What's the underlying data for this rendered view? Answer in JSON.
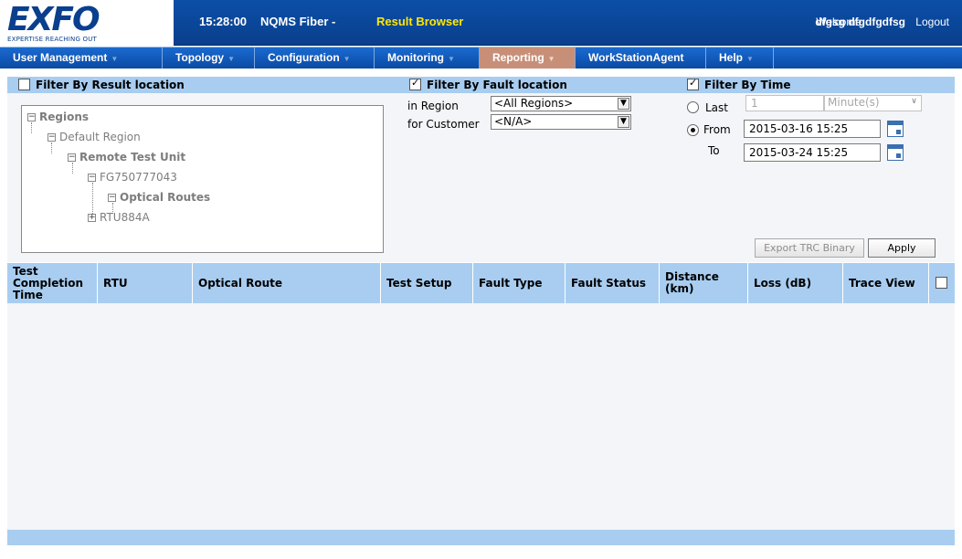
{
  "header": {
    "logo_text": "EXFO",
    "logo_tagline": "EXPERTISE REACHING OUT",
    "time": "15:28:00",
    "app_name": "NQMS Fiber -",
    "page_name": "Result Browser",
    "welcome": "Welcome",
    "username": "dfgsg dfgdfgdfsg",
    "logout": "Logout"
  },
  "nav": {
    "items": [
      {
        "label": "User Management"
      },
      {
        "label": "Topology"
      },
      {
        "label": "Configuration"
      },
      {
        "label": "Monitoring"
      },
      {
        "label": "Reporting"
      },
      {
        "label": "WorkStationAgent"
      },
      {
        "label": "Help"
      }
    ],
    "active_index": 4,
    "active_color": "#c88f78"
  },
  "filters": {
    "result_location": {
      "label": "Filter By Result location",
      "checked": false
    },
    "fault_location": {
      "label": "Filter By Fault location",
      "checked": true,
      "region_label": "in Region",
      "region_value": "<All Regions>",
      "customer_label": "for Customer",
      "customer_value": "<N/A>"
    },
    "time": {
      "label": "Filter By Time",
      "checked": true,
      "last_label": "Last",
      "last_value": "1",
      "last_unit": "Minute(s)",
      "from_label": "From",
      "from_value": "2015-03-16 15:25",
      "to_label": "To",
      "to_value": "2015-03-24 15:25",
      "mode": "From"
    }
  },
  "tree": {
    "root": "Regions",
    "default_region": "Default Region",
    "remote_test_unit": "Remote Test Unit",
    "rtu1": "FG750777043",
    "optical_routes": "Optical Routes",
    "rtu2": "RTU884A"
  },
  "buttons": {
    "export": "Export TRC Binary",
    "apply": "Apply"
  },
  "table": {
    "columns": [
      "Test Completion Time",
      "RTU",
      "Optical Route",
      "Test Setup",
      "Fault Type",
      "Fault Status",
      "Distance (km)",
      "Loss (dB)",
      "Trace View"
    ],
    "rows": []
  },
  "colors": {
    "header_blue": "#0b4fa8",
    "accent_yellow": "#ffe800",
    "band_blue": "#a8cdf0",
    "panel_bg": "#f3f5f8"
  }
}
